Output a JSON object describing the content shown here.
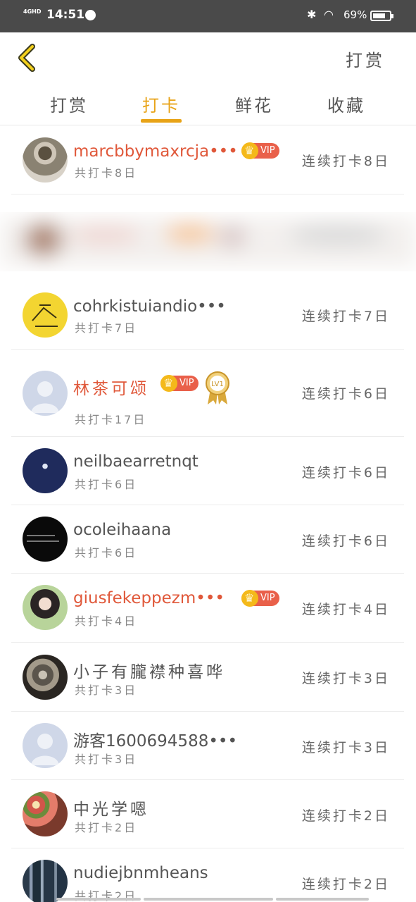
{
  "status": {
    "network": "4GHD",
    "time": "14:51",
    "battery": "69%"
  },
  "header": {
    "action_label": "打赏"
  },
  "tabs": [
    {
      "label": "打赏",
      "active": false
    },
    {
      "label": "打卡",
      "active": true
    },
    {
      "label": "鲜花",
      "active": false
    },
    {
      "label": "收藏",
      "active": false
    }
  ],
  "rows": [
    {
      "name": "marcbbymaxrcja•••",
      "vip": true,
      "total": "共打卡8日",
      "streak": "连续打卡8日",
      "avatar": "photo-person"
    },
    {
      "name": "cohrkistuiandio•••",
      "vip": false,
      "total": "共打卡7日",
      "streak": "连续打卡7日",
      "avatar": "yellow-drawing"
    },
    {
      "name": "林茶可颂",
      "vip": true,
      "medal": "LV1",
      "total": "共打卡17日",
      "streak": "连续打卡6日",
      "avatar": "default-avatar"
    },
    {
      "name": "neilbaearretnqt",
      "vip": false,
      "total": "共打卡6日",
      "streak": "连续打卡6日",
      "avatar": "navy-logo"
    },
    {
      "name": "ocoleihaana",
      "vip": false,
      "total": "共打卡6日",
      "streak": "连续打卡6日",
      "avatar": "black-text"
    },
    {
      "name": "giusfekeppezm•••",
      "vip": true,
      "total": "共打卡4日",
      "streak": "连续打卡4日",
      "avatar": "photo-girl"
    },
    {
      "name": "小子有朧襟种喜哗",
      "vip": false,
      "total": "共打卡3日",
      "streak": "连续打卡3日",
      "avatar": "photo-tiger"
    },
    {
      "name": "游客1600694588•••",
      "vip": false,
      "total": "共打卡3日",
      "streak": "连续打卡3日",
      "avatar": "default-avatar"
    },
    {
      "name": "中光学嗯",
      "vip": false,
      "total": "共打卡2日",
      "streak": "连续打卡2日",
      "avatar": "photo-flowers"
    },
    {
      "name": "nudiejbnmheans",
      "vip": false,
      "total": "共打卡2日",
      "streak": "连续打卡2日",
      "avatar": "photo-forest"
    }
  ],
  "vip_label": "VIP",
  "colors": {
    "accent": "#e8a317",
    "vip_name": "#e0583a",
    "vip_badge": "#e9604a",
    "crown": "#f4b91a"
  }
}
